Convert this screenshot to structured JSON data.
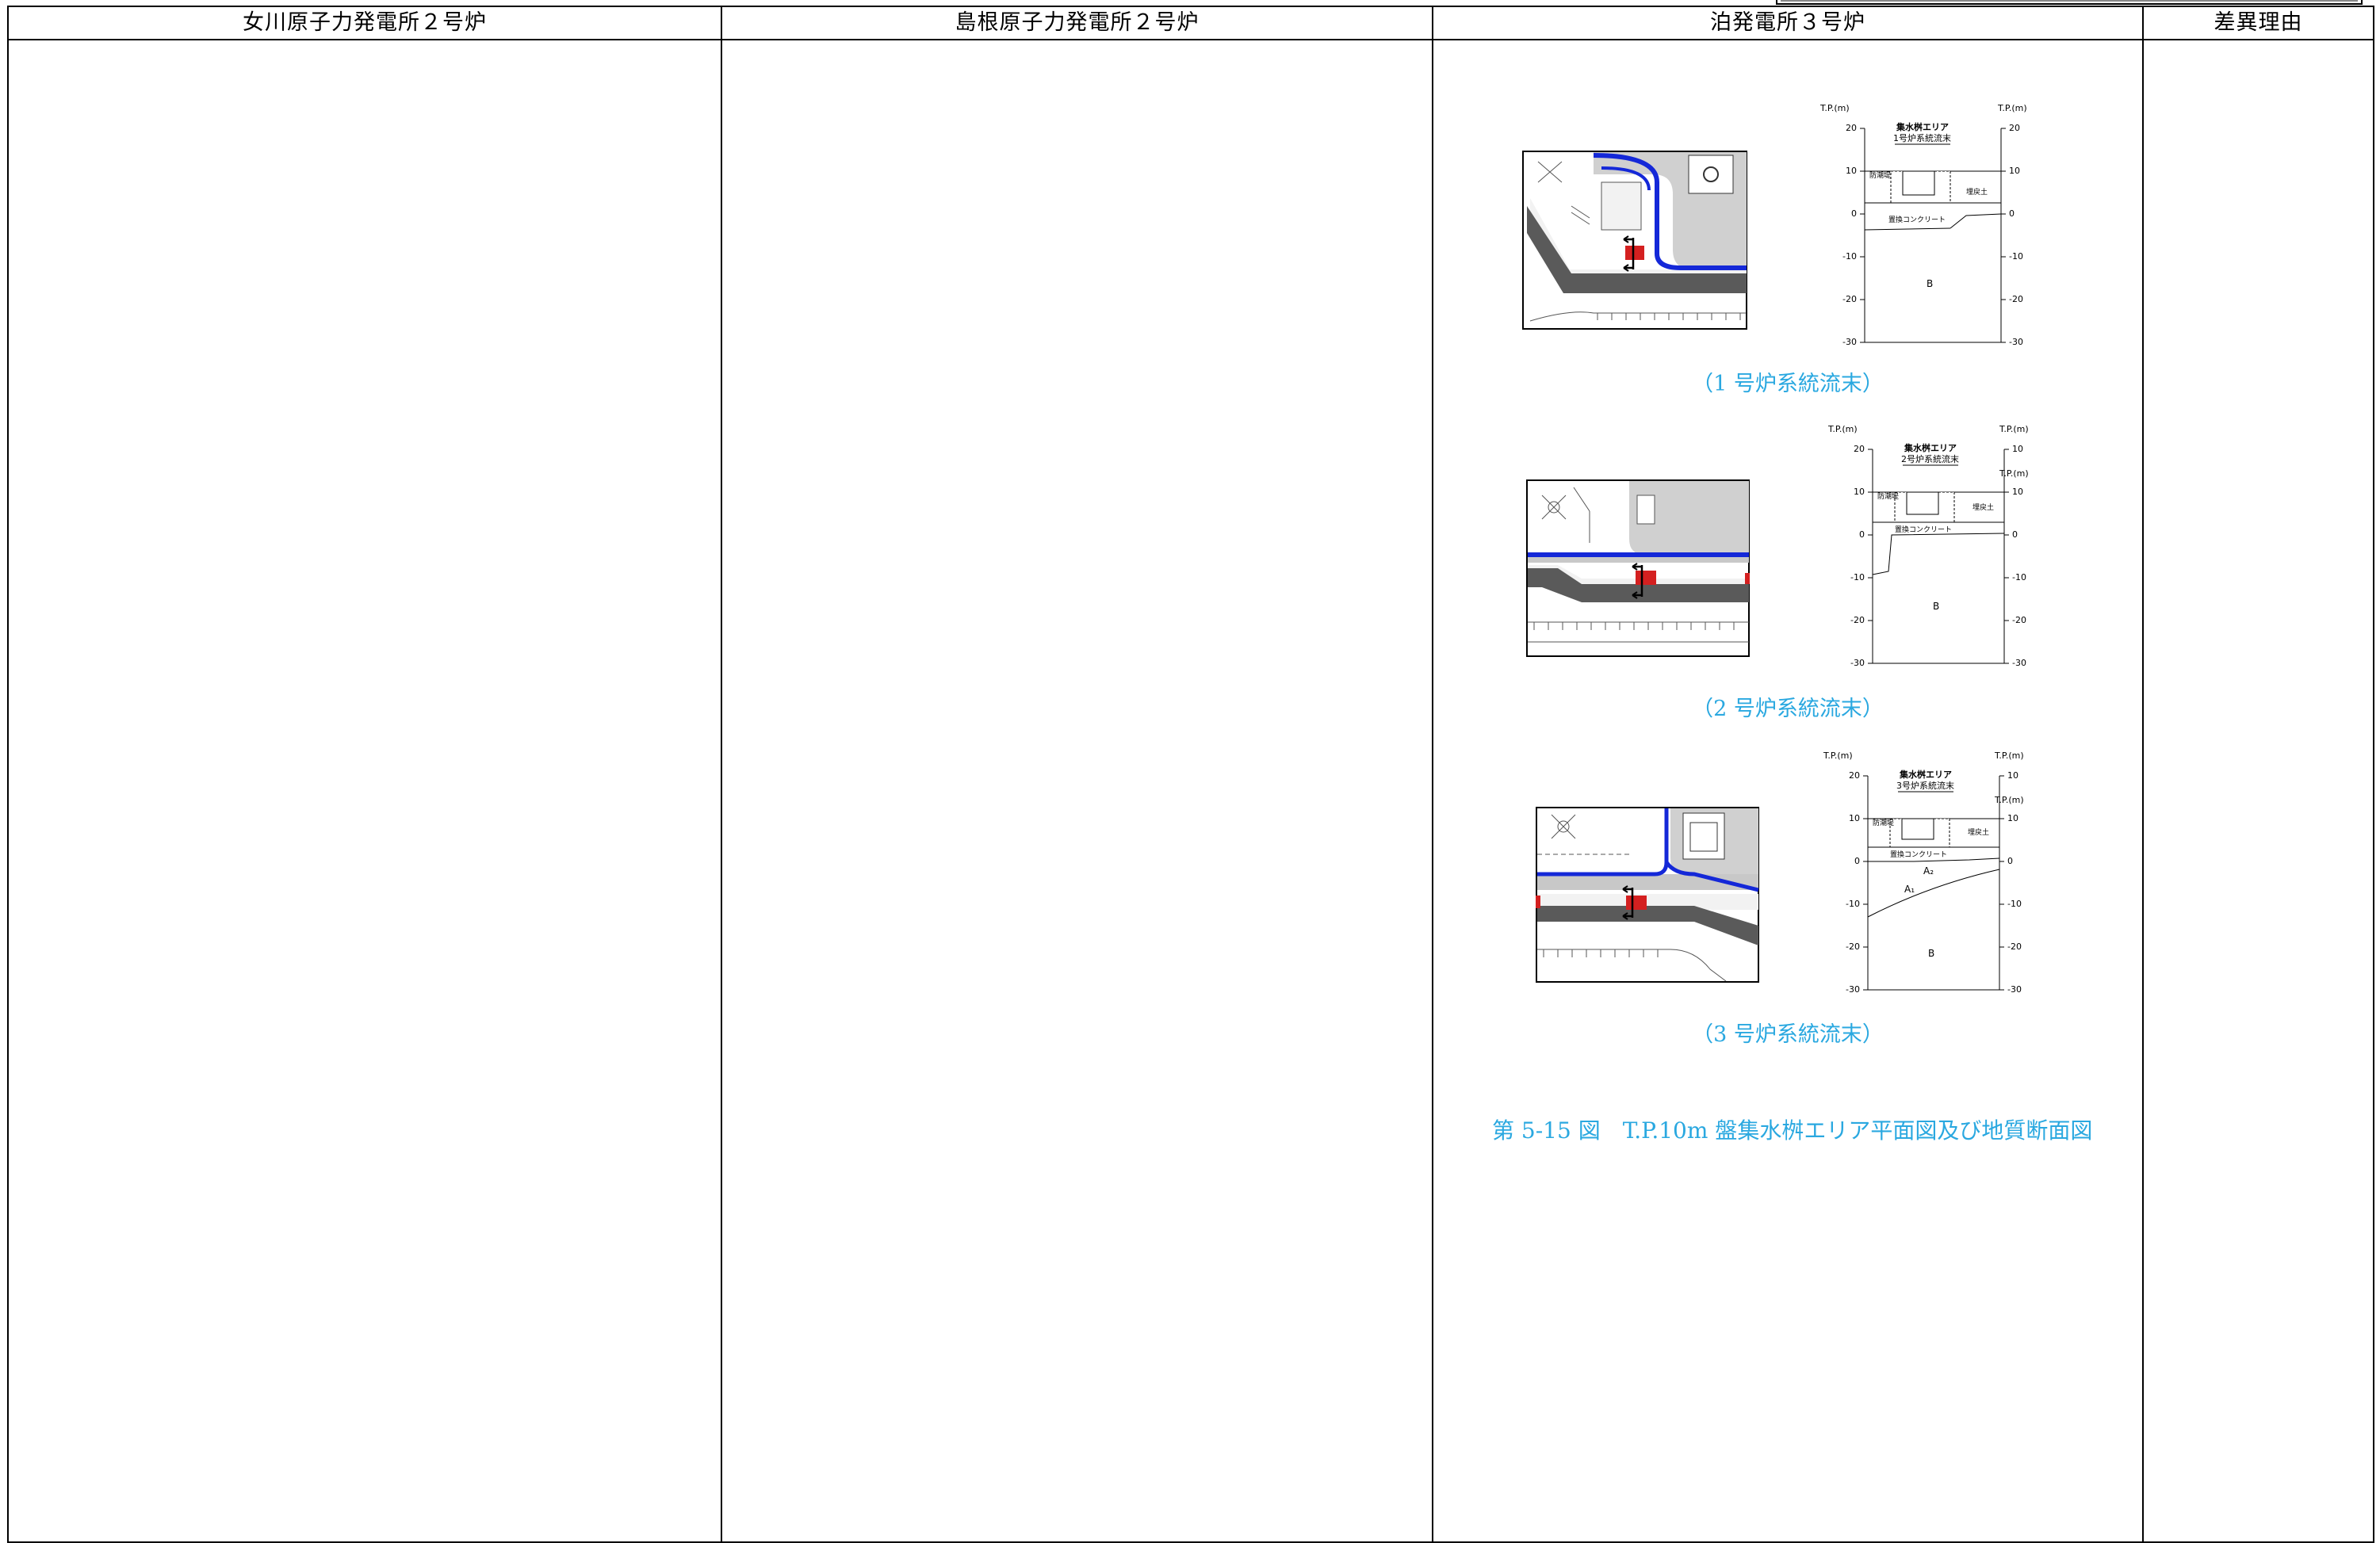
{
  "columns": {
    "onagawa": "女川原子力発電所２号炉",
    "shimane": "島根原子力発電所２号炉",
    "tomari": "泊発電所３号炉",
    "reason": "差異理由"
  },
  "figures": [
    {
      "caption": "（1 号炉系統流末）",
      "section": {
        "axis_label_left": "T.P.(m)",
        "axis_label_right": "T.P.(m)",
        "left_ticks": [
          "20",
          "10",
          "0",
          "-10",
          "-20",
          "-30"
        ],
        "right_ticks": [
          "20",
          "10",
          "0",
          "-10",
          "-20",
          "-30"
        ],
        "area_title": "集水桝エリア",
        "area_sub": "1号炉系統流末",
        "soil_label": "B",
        "label_a": "防潮堤",
        "label_b": "埋戻土",
        "label_c": "置換コンクリート"
      }
    },
    {
      "caption": "（2 号炉系統流末）",
      "section": {
        "axis_label_left": "T.P.(m)",
        "axis_label_right": "T.P.(m)",
        "axis_label_right2": "T.P.(m)",
        "left_ticks": [
          "20",
          "10",
          "0",
          "-10",
          "-20",
          "-30"
        ],
        "right_ticks": [
          "10",
          "10",
          "0",
          "-10",
          "-20",
          "-30"
        ],
        "area_title": "集水桝エリア",
        "area_sub": "2号炉系統流末",
        "soil_label": "B",
        "label_a": "防潮堤",
        "label_b": "埋戻土",
        "label_c": "置換コンクリート"
      }
    },
    {
      "caption": "（3 号炉系統流末）",
      "section": {
        "axis_label_left": "T.P.(m)",
        "axis_label_right": "T.P.(m)",
        "axis_label_right2": "T.P.(m)",
        "left_ticks": [
          "20",
          "10",
          "0",
          "-10",
          "-20",
          "-30"
        ],
        "right_ticks": [
          "10",
          "10",
          "0",
          "-10",
          "-20",
          "-30"
        ],
        "area_title": "集水桝エリア",
        "area_sub": "3号炉系統流末",
        "soil_label": "B",
        "soil_a2": "A₂",
        "soil_a1": "A₁",
        "label_a": "防潮堤",
        "label_b": "埋戻土",
        "label_c": "置換コンクリート"
      }
    }
  ],
  "figure_title": "第 5-15 図　T.P.10m 盤集水桝エリア平面図及び地質断面図",
  "colors": {
    "caption": "#2aa8e0",
    "drain": "#1428d8",
    "road": "#555555",
    "marker": "#d42020"
  }
}
